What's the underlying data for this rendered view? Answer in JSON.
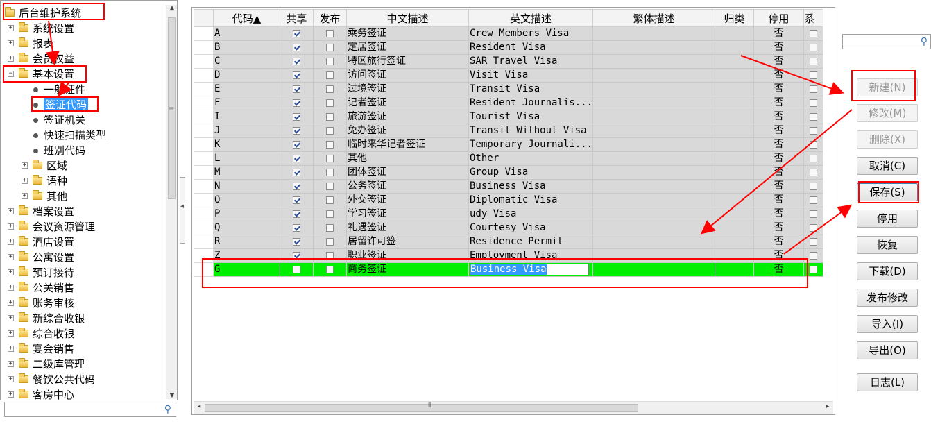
{
  "tree": {
    "items": [
      {
        "label": "后台维护系统",
        "level": 0,
        "type": "folder",
        "expander": ""
      },
      {
        "label": "系统设置",
        "level": 1,
        "type": "folder",
        "expander": "+"
      },
      {
        "label": "报表",
        "level": 1,
        "type": "folder",
        "expander": "+"
      },
      {
        "label": "会员权益",
        "level": 1,
        "type": "folder",
        "expander": "+"
      },
      {
        "label": "基本设置",
        "level": 1,
        "type": "folder",
        "expander": "−"
      },
      {
        "label": "一般证件",
        "level": 2,
        "type": "bullet",
        "expander": ""
      },
      {
        "label": "签证代码",
        "level": 2,
        "type": "bullet",
        "expander": "",
        "selected": true
      },
      {
        "label": "签证机关",
        "level": 2,
        "type": "bullet",
        "expander": ""
      },
      {
        "label": "快速扫描类型",
        "level": 2,
        "type": "bullet",
        "expander": ""
      },
      {
        "label": "班别代码",
        "level": 2,
        "type": "bullet",
        "expander": ""
      },
      {
        "label": "区域",
        "level": 2,
        "type": "folder",
        "expander": "+"
      },
      {
        "label": "语种",
        "level": 2,
        "type": "folder",
        "expander": "+"
      },
      {
        "label": "其他",
        "level": 2,
        "type": "folder",
        "expander": "+"
      },
      {
        "label": "档案设置",
        "level": 1,
        "type": "folder",
        "expander": "+"
      },
      {
        "label": "会议资源管理",
        "level": 1,
        "type": "folder",
        "expander": "+"
      },
      {
        "label": "酒店设置",
        "level": 1,
        "type": "folder",
        "expander": "+"
      },
      {
        "label": "公寓设置",
        "level": 1,
        "type": "folder",
        "expander": "+"
      },
      {
        "label": "预订接待",
        "level": 1,
        "type": "folder",
        "expander": "+"
      },
      {
        "label": "公关销售",
        "level": 1,
        "type": "folder",
        "expander": "+"
      },
      {
        "label": "账务审核",
        "level": 1,
        "type": "folder",
        "expander": "+"
      },
      {
        "label": "新综合收银",
        "level": 1,
        "type": "folder",
        "expander": "+"
      },
      {
        "label": "综合收银",
        "level": 1,
        "type": "folder",
        "expander": "+"
      },
      {
        "label": "宴会销售",
        "level": 1,
        "type": "folder",
        "expander": "+"
      },
      {
        "label": "二级库管理",
        "level": 1,
        "type": "folder",
        "expander": "+"
      },
      {
        "label": "餐饮公共代码",
        "level": 1,
        "type": "folder",
        "expander": "+"
      },
      {
        "label": "客房中心",
        "level": 1,
        "type": "folder",
        "expander": "+"
      }
    ],
    "search_value": ""
  },
  "grid": {
    "columns": [
      "代码▲",
      "共享",
      "发布",
      "中文描述",
      "英文描述",
      "繁体描述",
      "归类",
      "停用",
      "系"
    ],
    "rows": [
      {
        "code": "A",
        "shared": true,
        "publish": false,
        "cn": "乘务签证",
        "en": "Crew Members Visa",
        "tw": "",
        "category": "",
        "disabled": "否"
      },
      {
        "code": "B",
        "shared": true,
        "publish": false,
        "cn": "定居签证",
        "en": "Resident Visa",
        "tw": "",
        "category": "",
        "disabled": "否"
      },
      {
        "code": "C",
        "shared": true,
        "publish": false,
        "cn": "特区旅行签证",
        "en": "SAR Travel Visa",
        "tw": "",
        "category": "",
        "disabled": "否"
      },
      {
        "code": "D",
        "shared": true,
        "publish": false,
        "cn": "访问签证",
        "en": "Visit Visa",
        "tw": "",
        "category": "",
        "disabled": "否"
      },
      {
        "code": "E",
        "shared": true,
        "publish": false,
        "cn": "过境签证",
        "en": "Transit Visa",
        "tw": "",
        "category": "",
        "disabled": "否"
      },
      {
        "code": "F",
        "shared": true,
        "publish": false,
        "cn": "记者签证",
        "en": "Resident Journalis...",
        "tw": "",
        "category": "",
        "disabled": "否"
      },
      {
        "code": "I",
        "shared": true,
        "publish": false,
        "cn": "旅游签证",
        "en": "Tourist Visa",
        "tw": "",
        "category": "",
        "disabled": "否"
      },
      {
        "code": "J",
        "shared": true,
        "publish": false,
        "cn": "免办签证",
        "en": "Transit Without Visa",
        "tw": "",
        "category": "",
        "disabled": "否"
      },
      {
        "code": "K",
        "shared": true,
        "publish": false,
        "cn": "临时来华记者签证",
        "en": "Temporary Journali...",
        "tw": "",
        "category": "",
        "disabled": "否"
      },
      {
        "code": "L",
        "shared": true,
        "publish": false,
        "cn": "其他",
        "en": "Other",
        "tw": "",
        "category": "",
        "disabled": "否"
      },
      {
        "code": "M",
        "shared": true,
        "publish": false,
        "cn": "团体签证",
        "en": "Group Visa",
        "tw": "",
        "category": "",
        "disabled": "否"
      },
      {
        "code": "N",
        "shared": true,
        "publish": false,
        "cn": "公务签证",
        "en": "Business Visa",
        "tw": "",
        "category": "",
        "disabled": "否"
      },
      {
        "code": "O",
        "shared": true,
        "publish": false,
        "cn": "外交签证",
        "en": "Diplomatic Visa",
        "tw": "",
        "category": "",
        "disabled": "否"
      },
      {
        "code": "P",
        "shared": true,
        "publish": false,
        "cn": "学习签证",
        "en": "udy Visa",
        "tw": "",
        "category": "",
        "disabled": "否"
      },
      {
        "code": "Q",
        "shared": true,
        "publish": false,
        "cn": "礼遇签证",
        "en": "Courtesy Visa",
        "tw": "",
        "category": "",
        "disabled": "否"
      },
      {
        "code": "R",
        "shared": true,
        "publish": false,
        "cn": "居留许可签",
        "en": "Residence Permit",
        "tw": "",
        "category": "",
        "disabled": "否"
      },
      {
        "code": "Z",
        "shared": true,
        "publish": false,
        "cn": "职业签证",
        "en": "Employment Visa",
        "tw": "",
        "category": "",
        "disabled": "否"
      },
      {
        "code": "G",
        "shared": false,
        "publish": false,
        "cn": "商务签证",
        "en": " Business Visa",
        "tw": "",
        "category": "",
        "disabled": "否",
        "new": true
      }
    ]
  },
  "search_right": {
    "value": ""
  },
  "buttons": [
    {
      "label": "新建(N)",
      "state": "disabled"
    },
    {
      "label": "修改(M)",
      "state": "disabled"
    },
    {
      "label": "删除(X)",
      "state": "disabled"
    },
    {
      "label": "取消(C)",
      "state": "enabled"
    },
    {
      "label": "保存(S)",
      "state": "focused"
    },
    {
      "label": "停用",
      "state": "enabled"
    },
    {
      "label": "恢复",
      "state": "enabled"
    },
    {
      "label": "下载(D)",
      "state": "enabled"
    },
    {
      "label": "发布修改",
      "state": "enabled"
    },
    {
      "label": "导入(I)",
      "state": "enabled"
    },
    {
      "label": "导出(O)",
      "state": "enabled"
    },
    {
      "label": "日志(L)",
      "state": "enabled"
    }
  ],
  "colors": {
    "annotation": "#ff0000",
    "new_row": "#00ee00",
    "selection": "#3399ff"
  }
}
